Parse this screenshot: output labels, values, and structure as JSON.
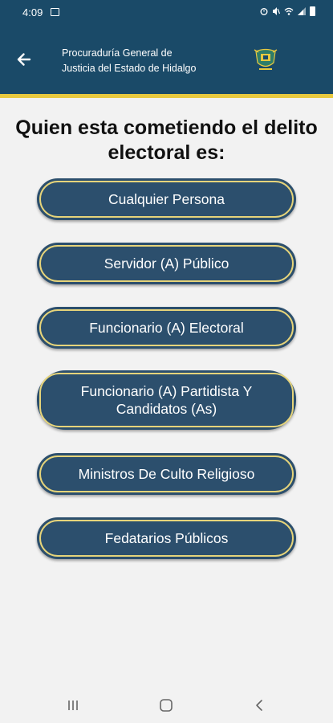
{
  "status_bar": {
    "time": "4:09",
    "icons": [
      "image-icon",
      "alarm-icon",
      "mute-icon",
      "wifi-icon",
      "signal-icon",
      "battery-icon"
    ]
  },
  "app_bar": {
    "back_icon": "arrow-left-icon",
    "title_line1": "Procuraduría General de",
    "title_line2": "Justicia del Estado de Hidalgo",
    "logo_icon": "coat-of-arms-icon"
  },
  "main": {
    "heading_line1": "Quien esta cometiendo el delito",
    "heading_line2": "electoral es:",
    "options": [
      {
        "label": "Cualquier Persona"
      },
      {
        "label": "Servidor (A) Público"
      },
      {
        "label": "Funcionario (A) Electoral"
      },
      {
        "label": "Funcionario (A) Partidista Y Candidatos (As)"
      },
      {
        "label": "Ministros De Culto Religioso"
      },
      {
        "label": "Fedatarios Públicos"
      }
    ]
  },
  "nav_bar": {
    "icons": [
      "recent-apps-icon",
      "home-icon",
      "back-icon"
    ]
  },
  "colors": {
    "header": "#1a4a68",
    "accent_stripe": "#e8c93f",
    "button_fill": "#2c4f6d",
    "button_border": "#e6d47a",
    "background": "#f2f2f2"
  }
}
